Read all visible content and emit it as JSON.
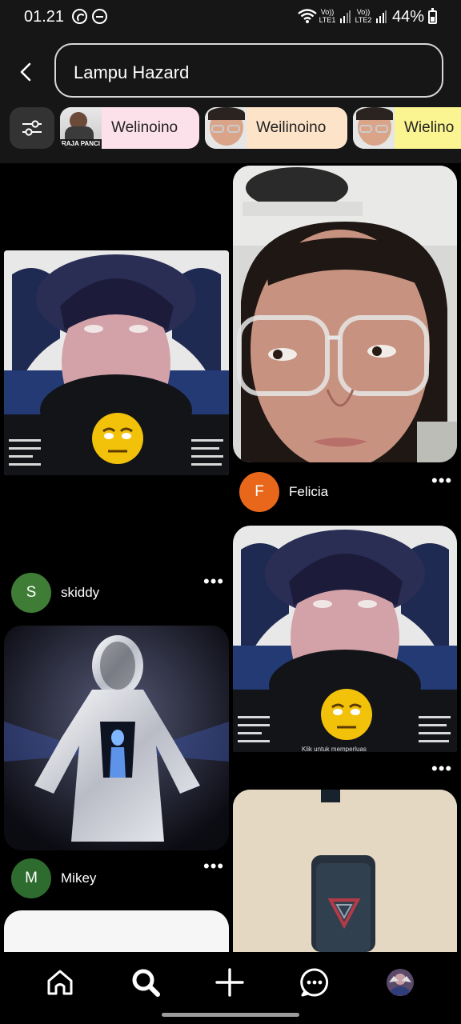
{
  "status_bar": {
    "time": "01.21",
    "lte1": "Vo)) LTE1",
    "lte2": "Vo)) LTE2",
    "battery": "44%"
  },
  "search": {
    "query": "Lampu Hazard"
  },
  "chips": [
    {
      "label": "Welinoino",
      "color": "#fde1ea",
      "thumb_caption": "RAJA PANCI"
    },
    {
      "label": "Weilinoino",
      "color": "#fde3c8"
    },
    {
      "label": "Wielino",
      "color": "#fbf591"
    }
  ],
  "pins": [
    {
      "author": "skiddy",
      "initial": "S",
      "avatar_color": "#3f7d36",
      "overlay": "Klik untuk memperluas",
      "more": "•••"
    },
    {
      "author": "Felicia",
      "initial": "F",
      "avatar_color": "#e8671a",
      "more": "•••"
    },
    {
      "author": "Mikey",
      "initial": "M",
      "avatar_color": "#2e6b2f",
      "more": "•••"
    },
    {
      "author": "",
      "overlay": "Klik untuk memperluas",
      "more": "•••"
    }
  ],
  "nav": {
    "items": [
      "home-icon",
      "search-icon",
      "create-icon",
      "messages-icon",
      "profile-icon"
    ]
  },
  "colors": {
    "background": "#000000",
    "header": "#161616"
  }
}
